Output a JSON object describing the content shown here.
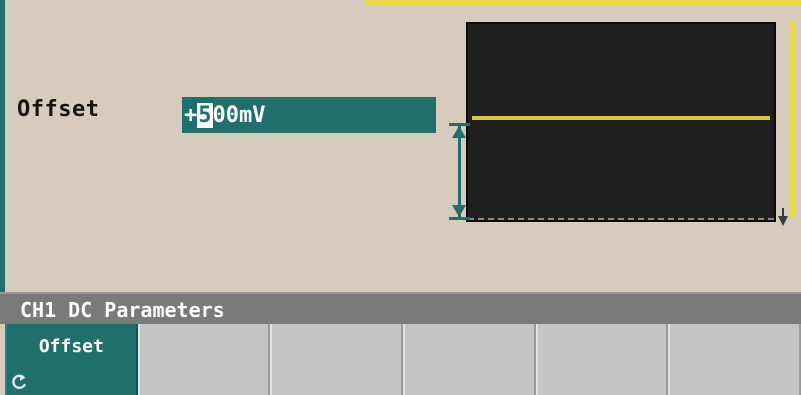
{
  "parameter": {
    "label": "Offset",
    "value_sign": "+",
    "value_cursor_digit": "5",
    "value_rest": "00mV"
  },
  "status": {
    "title": "CH1 DC Parameters"
  },
  "softkeys": [
    {
      "label": "Offset",
      "active": true
    },
    {
      "label": "",
      "active": false
    },
    {
      "label": "",
      "active": false
    },
    {
      "label": "",
      "active": false
    },
    {
      "label": "",
      "active": false
    },
    {
      "label": "",
      "active": false
    }
  ],
  "colors": {
    "accent": "#1f706d",
    "trace": "#d8c83c",
    "background": "#d6cbbd",
    "status_bar": "#7a7a7a"
  },
  "icons": {
    "back": "back-arrow-icon"
  }
}
